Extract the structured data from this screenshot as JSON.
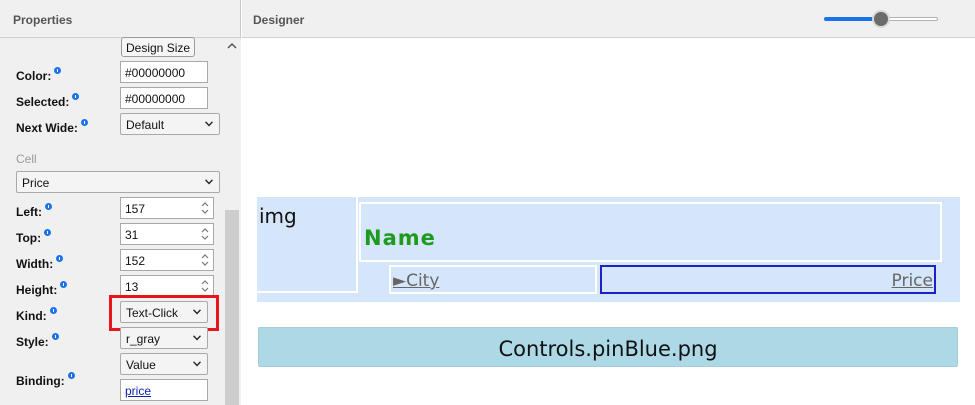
{
  "properties": {
    "title": "Properties",
    "design_size_button": "Design Size",
    "fields": {
      "color": {
        "label": "Color:",
        "value": "#00000000"
      },
      "selected": {
        "label": "Selected:",
        "value": "#00000000"
      },
      "next_wide": {
        "label": "Next Wide:",
        "value": "Default"
      }
    },
    "cell_section": "Cell",
    "cell_select": "Price",
    "cell_fields": {
      "left": {
        "label": "Left:",
        "value": "157"
      },
      "top": {
        "label": "Top:",
        "value": "31"
      },
      "width": {
        "label": "Width:",
        "value": "152"
      },
      "height": {
        "label": "Height:",
        "value": "13"
      },
      "kind": {
        "label": "Kind:",
        "value": "Text-Click"
      },
      "style": {
        "label": "Style:",
        "value": "r_gray"
      },
      "binding": {
        "label": "Binding:",
        "value": "Value",
        "field": "price"
      }
    }
  },
  "designer": {
    "title": "Designer",
    "zoom_level": 0.5,
    "cells": {
      "img": "img",
      "name": "Name",
      "city": "►City",
      "price": "Price"
    },
    "pin_bar": "Controls.pinBlue.png"
  },
  "colors": {
    "accent": "#1a73e8",
    "highlight": "#e8141b",
    "name_text": "#1e9a1e",
    "row_bg": "#d5e5fa",
    "pin_bg": "#add8e6",
    "selected_border": "#1c22c8"
  }
}
